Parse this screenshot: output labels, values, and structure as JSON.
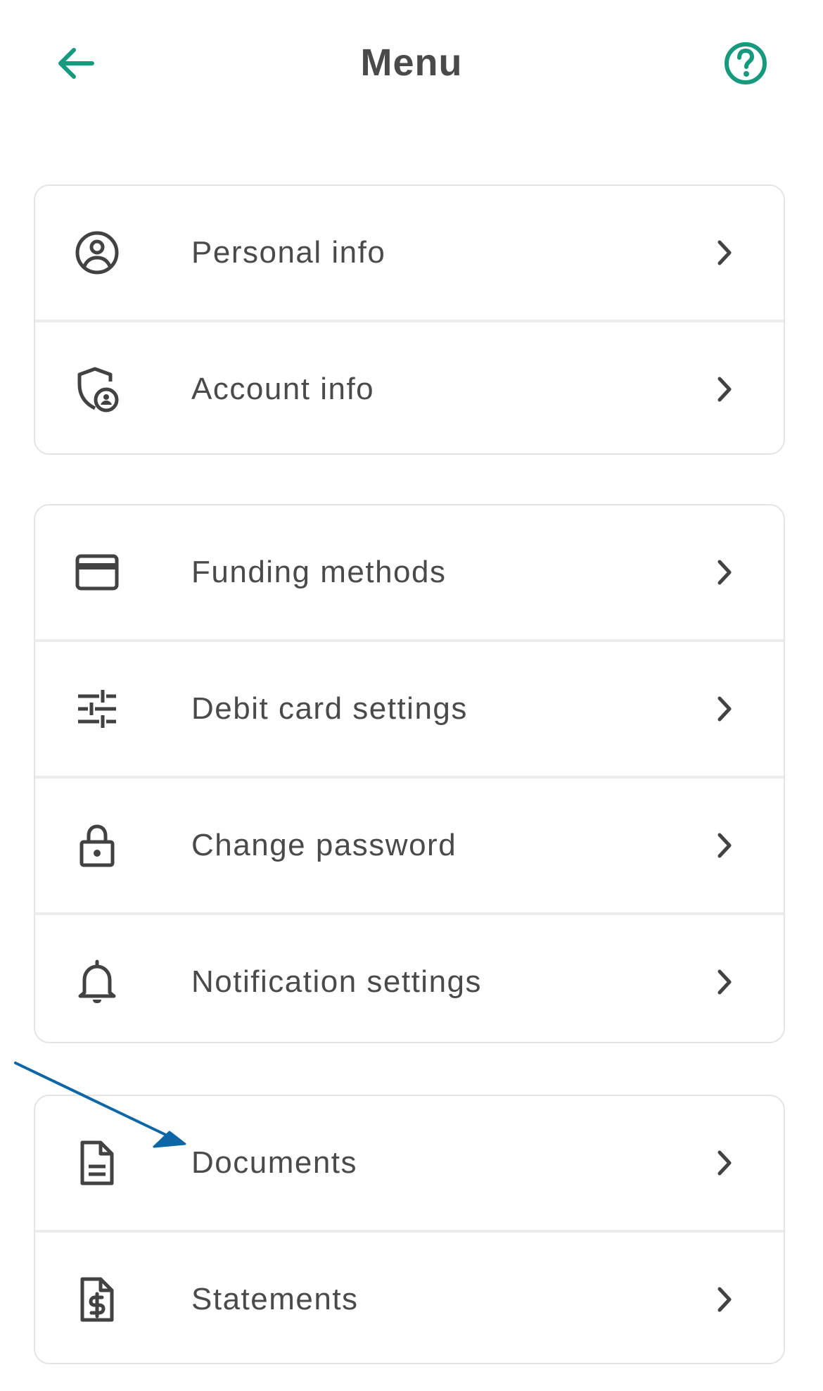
{
  "header": {
    "title": "Menu",
    "back_icon": "arrow-left-icon",
    "help_icon": "help-circle-icon"
  },
  "colors": {
    "accent": "#169a7e",
    "text": "#4a4a4a",
    "icon": "#424242",
    "annotation_arrow": "#0d67a6"
  },
  "groups": [
    {
      "items": [
        {
          "label": "Personal info",
          "icon": "user-circle-icon"
        },
        {
          "label": "Account info",
          "icon": "shield-user-icon"
        }
      ]
    },
    {
      "items": [
        {
          "label": "Funding methods",
          "icon": "credit-card-icon"
        },
        {
          "label": "Debit card settings",
          "icon": "sliders-icon"
        },
        {
          "label": "Change password",
          "icon": "lock-icon"
        },
        {
          "label": "Notification settings",
          "icon": "bell-icon"
        }
      ]
    },
    {
      "items": [
        {
          "label": "Documents",
          "icon": "document-icon"
        },
        {
          "label": "Statements",
          "icon": "dollar-document-icon"
        }
      ]
    }
  ],
  "annotation": {
    "points_to": "Documents"
  }
}
